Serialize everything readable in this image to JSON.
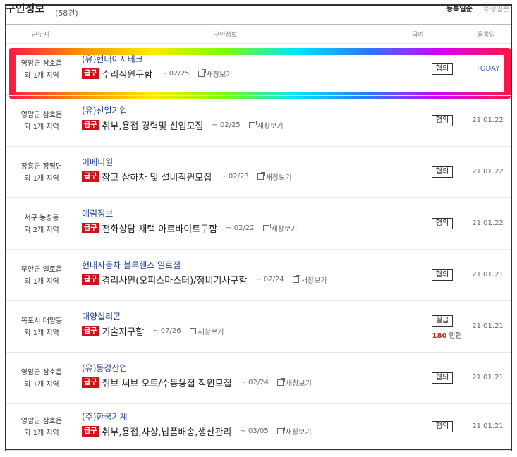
{
  "header": {
    "title": "구인정보",
    "count": "(58건)",
    "sort_active": "등록일순",
    "sort_sep": "|",
    "sort_other": "수정일순"
  },
  "columns": {
    "region": "근무지",
    "info": "구인정보",
    "pay": "급여",
    "date": "등록일"
  },
  "badge_label": "급구",
  "new_window_label": "새창보기",
  "rows": [
    {
      "loc1": "영암군 삼호읍",
      "loc2": "외 1개 지역",
      "company": "(유)현대이지테크",
      "title": "수리직원구함",
      "deadline": "~ 02/25",
      "pay_type": "협의",
      "pay_amount": "",
      "pay_unit": "",
      "date": "TODAY"
    },
    {
      "loc1": "영암군 삼호읍",
      "loc2": "외 1개 지역",
      "company": "(유)신일기업",
      "title": "취부,용접 경력및 신입모집",
      "deadline": "~ 02/25",
      "pay_type": "협의",
      "pay_amount": "",
      "pay_unit": "",
      "date": "21.01.22"
    },
    {
      "loc1": "장흥군 장평면",
      "loc2": "외 1개 지역",
      "company": "이메디원",
      "title": "창고 상하차 및 설비직원모집",
      "deadline": "~ 02/23",
      "pay_type": "협의",
      "pay_amount": "",
      "pay_unit": "",
      "date": "21.01.22"
    },
    {
      "loc1": "서구 농성동",
      "loc2": "외 2개 지역",
      "company": "예림정보",
      "title": "전화상담 재택 아르바이트구함",
      "deadline": "~ 02/22",
      "pay_type": "협의",
      "pay_amount": "",
      "pay_unit": "",
      "date": "21.01.22"
    },
    {
      "loc1": "무안군 일로읍",
      "loc2": "외 1개 지역",
      "company": "현대자동차 블루핸즈 일로점",
      "title": "경리사원(오피스마스터)/정비기사구함",
      "deadline": "~ 02/24",
      "pay_type": "협의",
      "pay_amount": "",
      "pay_unit": "",
      "date": "21.01.21"
    },
    {
      "loc1": "목포시 대양동",
      "loc2": "외 1개 지역",
      "company": "대양실리콘",
      "title": "기술자구함",
      "deadline": "~ 07/26",
      "pay_type": "월급",
      "pay_amount": "180",
      "pay_unit": "만원",
      "date": "21.01.21"
    },
    {
      "loc1": "영암군 삼호읍",
      "loc2": "외 1개 지역",
      "company": "(유)동강산업",
      "title": "취브 써브 오트/수동용접 직원모집",
      "deadline": "~ 02/24",
      "pay_type": "협의",
      "pay_amount": "",
      "pay_unit": "",
      "date": "21.01.21"
    },
    {
      "loc1": "영암군 삼호읍",
      "loc2": "외 1개 지역",
      "company": "(주)한국기계",
      "title": "취부,용접,사상,납품배송,생산관리",
      "deadline": "~ 03/05",
      "pay_type": "협의",
      "pay_amount": "",
      "pay_unit": "",
      "date": "21.01.21"
    }
  ]
}
